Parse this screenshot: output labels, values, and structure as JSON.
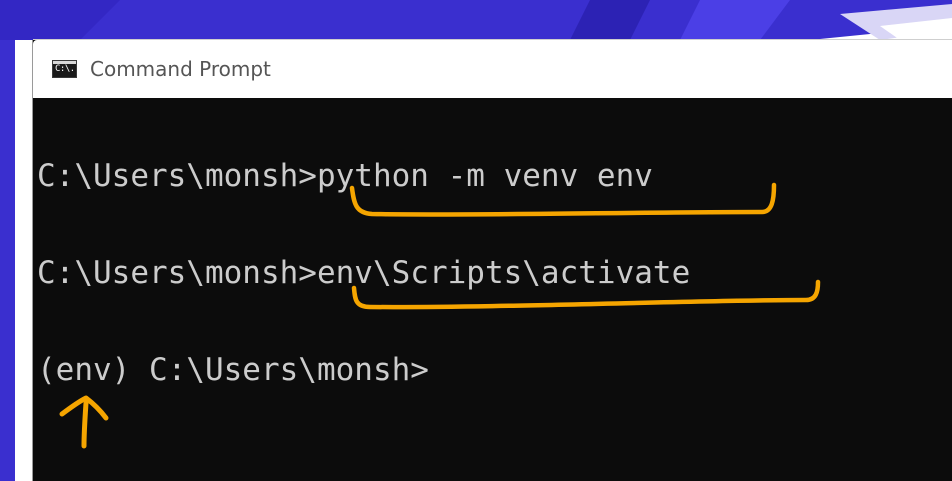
{
  "window": {
    "title": "Command Prompt",
    "icon": "cmd-icon",
    "icon_glyph": "C:\\."
  },
  "console": {
    "lines": [
      {
        "prompt": "C:\\Users\\monsh>",
        "command": "python -m venv env"
      },
      {
        "prompt": "C:\\Users\\monsh>",
        "command": "env\\Scripts\\activate"
      },
      {
        "prompt": "(env) C:\\Users\\monsh>",
        "command": ""
      }
    ]
  },
  "annotations": {
    "color": "#f5a500",
    "underlines": [
      "python -m venv env",
      "env\\Scripts\\activate"
    ],
    "arrow": "up-arrow-icon"
  },
  "colors": {
    "console_background": "#0c0c0c",
    "console_text": "#cccccc",
    "title_text": "#555555",
    "desktop_accent": "#3b2fd0"
  }
}
